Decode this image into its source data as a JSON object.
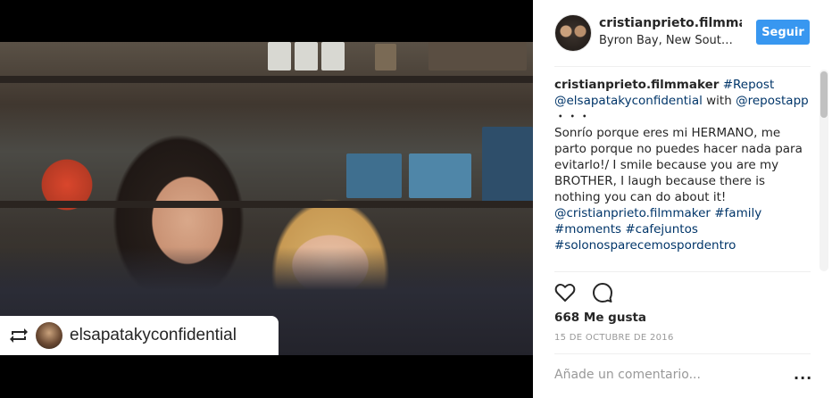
{
  "post": {
    "repost_badge_username": "elsapatakyconfidential"
  },
  "header": {
    "username": "cristianprieto.filmmake",
    "location": "Byron Bay, New Sout…",
    "follow_label": "Seguir"
  },
  "caption": {
    "author": "cristianprieto.filmmaker",
    "repost_tag": "#Repost",
    "mention_1": "@elsapatakyconfidential",
    "with_word": "with",
    "mention_2": "@repostapp",
    "dots": "・・・",
    "text": "Sonrío porque eres mi HERMANO, me parto porque no puedes hacer nada para evitarlo!/ I smile because you are my BROTHER, I laugh because there is nothing you can do about it!",
    "mention_3": "@cristianprieto.filmmaker",
    "tag_1": "#family",
    "tag_2": "#moments",
    "tag_3": "#cafejuntos",
    "tag_4": "#solonosparecemospordentro"
  },
  "stats": {
    "likes": "668 Me gusta",
    "date": "15 DE OCTUBRE DE 2016"
  },
  "comment_input": {
    "placeholder": "Añade un comentario...",
    "more": "..."
  },
  "icons": {
    "like": "heart-icon",
    "comment": "comment-icon",
    "repost": "repost-icon",
    "more": "more-options-icon"
  },
  "colors": {
    "accent": "#3897f0",
    "link": "#003569",
    "muted": "#999999"
  }
}
